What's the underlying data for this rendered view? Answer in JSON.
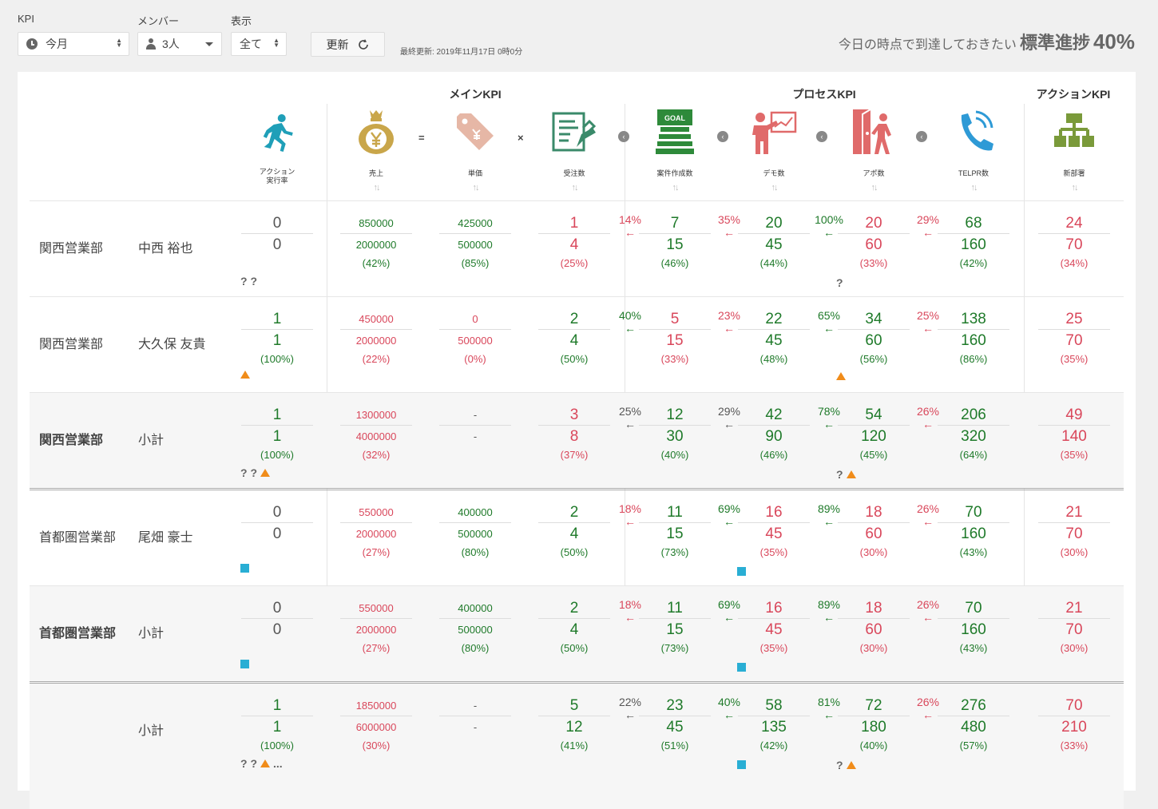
{
  "filters": {
    "kpi": {
      "label": "KPI",
      "value": "今月"
    },
    "member": {
      "label": "メンバー",
      "value": "3人"
    },
    "view": {
      "label": "表示",
      "value": "全て"
    }
  },
  "update_label": "更新",
  "last_updated": "最終更新: 2019年11月17日 0時0分",
  "standard": {
    "label": "今日の時点で到達しておきたい",
    "strong": "標準進捗",
    "value": "40%"
  },
  "groups": {
    "main": "メインKPI",
    "process": "プロセスKPI",
    "action": "アクションKPI"
  },
  "columns": {
    "exec": "アクション",
    "exec2": "実行率",
    "sales": "売上",
    "price": "単価",
    "orders": "受注数",
    "cases": "案件作成数",
    "demo": "デモ数",
    "appo": "アポ数",
    "telpr": "TELPR数",
    "newdept": "新部署"
  },
  "operators": {
    "eq": "=",
    "times": "×"
  },
  "sort_glyph": "↑↓",
  "goal_text": "GOAL",
  "arrow": "←",
  "colors": {
    "green": "#1f7a2a",
    "red": "#d9475b",
    "teal": "#1f9fb8",
    "gold": "#c9a64a",
    "coral": "#e06a6a"
  },
  "rows": [
    {
      "dept": "関西営業部",
      "member": "中西 裕也",
      "exec": [
        "0",
        "0",
        ""
      ],
      "sales": [
        "850000",
        "2000000",
        "(42%)"
      ],
      "price": [
        "425000",
        "500000",
        "(85%)"
      ],
      "orders": [
        "1",
        "4",
        "(25%)"
      ],
      "r1": "14%",
      "cases": [
        "7",
        "15",
        "(46%)"
      ],
      "r2": "35%",
      "demo": [
        "20",
        "45",
        "(44%)"
      ],
      "r3": "100%",
      "appo": [
        "20",
        "60",
        "(33%)"
      ],
      "r4": "29%",
      "telpr": [
        "68",
        "160",
        "(42%)"
      ],
      "newdept": [
        "24",
        "70",
        "(34%)"
      ],
      "mark1": "? ?",
      "mark2": "?"
    },
    {
      "dept": "関西営業部",
      "member": "大久保 友貴",
      "exec": [
        "1",
        "1",
        "(100%)"
      ],
      "sales": [
        "450000",
        "2000000",
        "(22%)"
      ],
      "price": [
        "0",
        "500000",
        "(0%)"
      ],
      "orders": [
        "2",
        "4",
        "(50%)"
      ],
      "r1": "40%",
      "cases": [
        "5",
        "15",
        "(33%)"
      ],
      "r2": "23%",
      "demo": [
        "22",
        "45",
        "(48%)"
      ],
      "r3": "65%",
      "appo": [
        "34",
        "60",
        "(56%)"
      ],
      "r4": "25%",
      "telpr": [
        "138",
        "160",
        "(86%)"
      ],
      "newdept": [
        "25",
        "70",
        "(35%)"
      ]
    },
    {
      "dept": "関西営業部",
      "member": "小計",
      "exec": [
        "1",
        "1",
        "(100%)"
      ],
      "sales": [
        "1300000",
        "4000000",
        "(32%)"
      ],
      "price": [
        "-",
        "-",
        ""
      ],
      "orders": [
        "3",
        "8",
        "(37%)"
      ],
      "r1": "25%",
      "cases": [
        "12",
        "30",
        "(40%)"
      ],
      "r2": "29%",
      "demo": [
        "42",
        "90",
        "(46%)"
      ],
      "r3": "78%",
      "appo": [
        "54",
        "120",
        "(45%)"
      ],
      "r4": "26%",
      "telpr": [
        "206",
        "320",
        "(64%)"
      ],
      "newdept": [
        "49",
        "140",
        "(35%)"
      ],
      "mark1": "? ?",
      "mark2": "?"
    },
    {
      "dept": "首都圏営業部",
      "member": "尾畑 豪士",
      "exec": [
        "0",
        "0",
        ""
      ],
      "sales": [
        "550000",
        "2000000",
        "(27%)"
      ],
      "price": [
        "400000",
        "500000",
        "(80%)"
      ],
      "orders": [
        "2",
        "4",
        "(50%)"
      ],
      "r1": "18%",
      "cases": [
        "11",
        "15",
        "(73%)"
      ],
      "r2": "69%",
      "demo": [
        "16",
        "45",
        "(35%)"
      ],
      "r3": "89%",
      "appo": [
        "18",
        "60",
        "(30%)"
      ],
      "r4": "26%",
      "telpr": [
        "70",
        "160",
        "(43%)"
      ],
      "newdept": [
        "21",
        "70",
        "(30%)"
      ]
    },
    {
      "dept": "首都圏営業部",
      "member": "小計",
      "exec": [
        "0",
        "0",
        ""
      ],
      "sales": [
        "550000",
        "2000000",
        "(27%)"
      ],
      "price": [
        "400000",
        "500000",
        "(80%)"
      ],
      "orders": [
        "2",
        "4",
        "(50%)"
      ],
      "r1": "18%",
      "cases": [
        "11",
        "15",
        "(73%)"
      ],
      "r2": "69%",
      "demo": [
        "16",
        "45",
        "(35%)"
      ],
      "r3": "89%",
      "appo": [
        "18",
        "60",
        "(30%)"
      ],
      "r4": "26%",
      "telpr": [
        "70",
        "160",
        "(43%)"
      ],
      "newdept": [
        "21",
        "70",
        "(30%)"
      ]
    },
    {
      "dept": "",
      "member": "小計",
      "exec": [
        "1",
        "1",
        "(100%)"
      ],
      "sales": [
        "1850000",
        "6000000",
        "(30%)"
      ],
      "price": [
        "-",
        "-",
        ""
      ],
      "orders": [
        "5",
        "12",
        "(41%)"
      ],
      "r1": "22%",
      "cases": [
        "23",
        "45",
        "(51%)"
      ],
      "r2": "40%",
      "demo": [
        "58",
        "135",
        "(42%)"
      ],
      "r3": "81%",
      "appo": [
        "72",
        "180",
        "(40%)"
      ],
      "r4": "26%",
      "telpr": [
        "276",
        "480",
        "(57%)"
      ],
      "newdept": [
        "70",
        "210",
        "(33%)"
      ],
      "mark1": "? ?",
      "mark1b": "...",
      "mark2": "?"
    }
  ]
}
